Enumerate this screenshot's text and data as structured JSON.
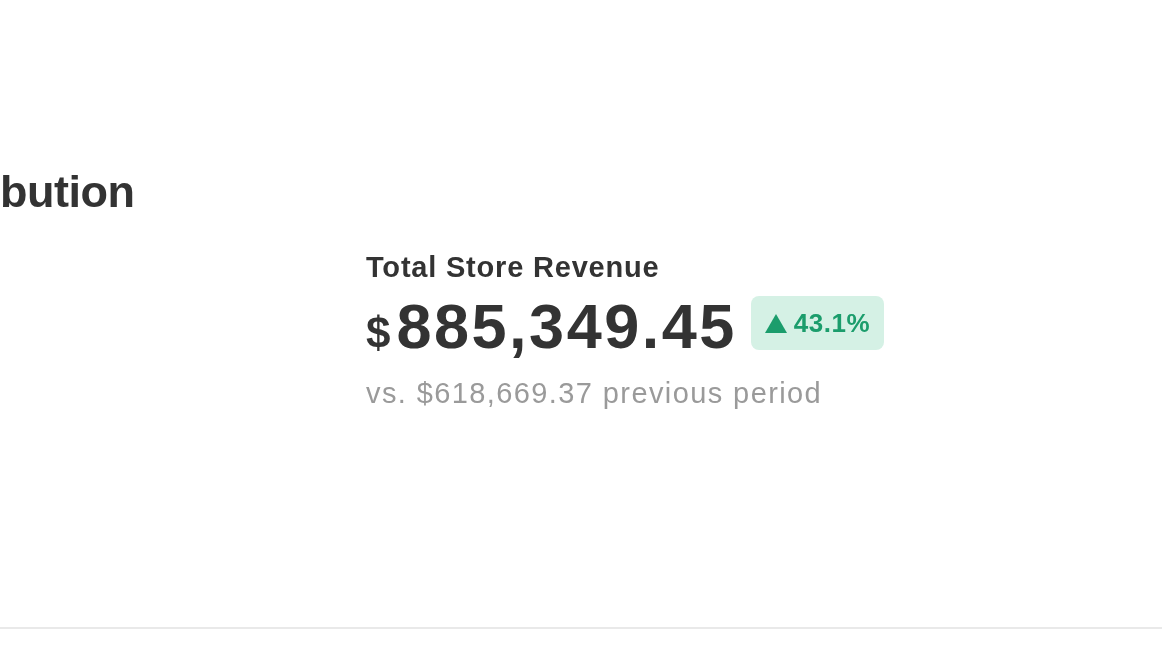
{
  "section": {
    "title": "bution"
  },
  "metric": {
    "label": "Total Store Revenue",
    "currency": "$",
    "value": "885,349.45",
    "change": {
      "increase": true,
      "text": "43.1%"
    },
    "comparison": "vs. $618,669.37 previous period"
  }
}
